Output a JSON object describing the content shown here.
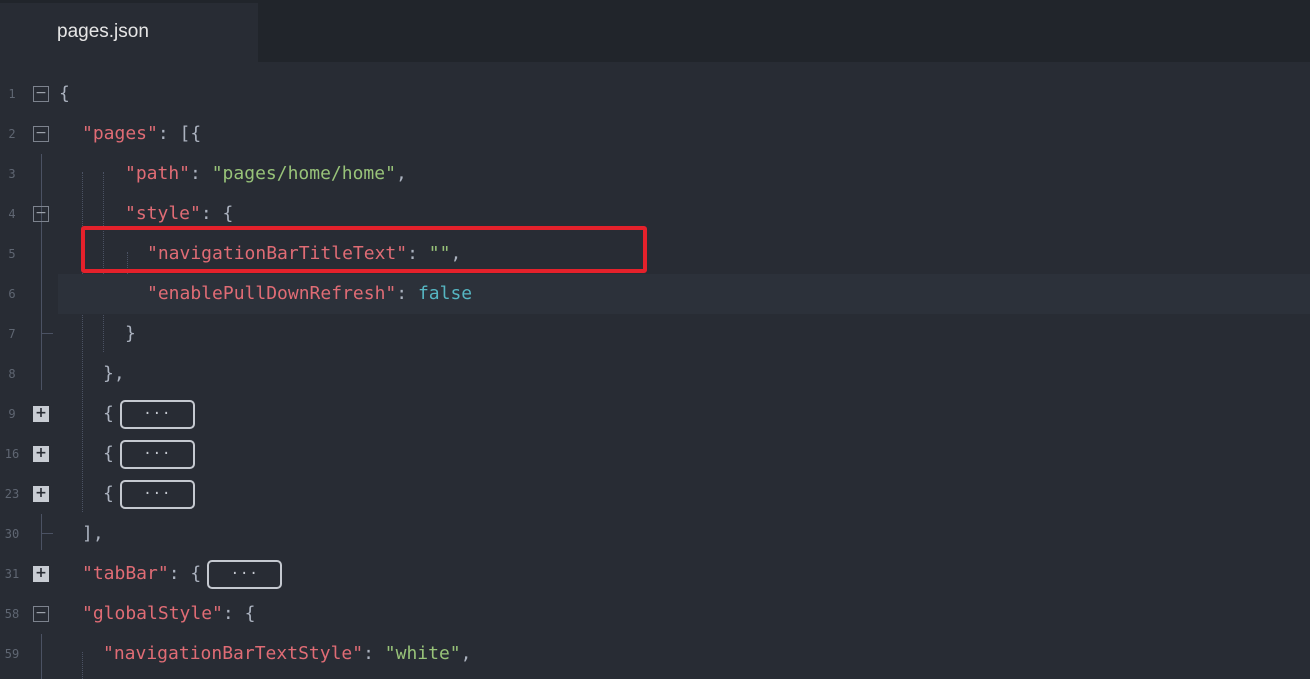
{
  "tab": {
    "label": "pages.json"
  },
  "lines": [
    {
      "num": "1",
      "fold": "minus"
    },
    {
      "num": "2",
      "fold": "minus"
    },
    {
      "num": "3",
      "fold": ""
    },
    {
      "num": "4",
      "fold": "minus"
    },
    {
      "num": "5",
      "fold": ""
    },
    {
      "num": "6",
      "fold": ""
    },
    {
      "num": "7",
      "fold": ""
    },
    {
      "num": "8",
      "fold": ""
    },
    {
      "num": "9",
      "fold": "plus"
    },
    {
      "num": "16",
      "fold": "plus"
    },
    {
      "num": "23",
      "fold": "plus"
    },
    {
      "num": "30",
      "fold": ""
    },
    {
      "num": "31",
      "fold": "plus"
    },
    {
      "num": "58",
      "fold": "minus"
    },
    {
      "num": "59",
      "fold": ""
    }
  ],
  "code": {
    "l1_open": "{",
    "l2_key": "\"pages\"",
    "l2_rest": ": [{",
    "l3_key": "\"path\"",
    "l3_colon": ": ",
    "l3_val": "\"pages/home/home\"",
    "l3_comma": ",",
    "l4_key": "\"style\"",
    "l4_rest": ": {",
    "l5_key": "\"navigationBarTitleText\"",
    "l5_colon": ": ",
    "l5_val": "\"\"",
    "l5_comma": ",",
    "l6_key": "\"enablePullDownRefresh\"",
    "l6_colon": ": ",
    "l6_val": "false",
    "l7_close": "}",
    "l8_close": "},",
    "l9_open": "{",
    "l16_open": "{",
    "l23_open": "{",
    "ellipsis": "···",
    "l30_close": "],",
    "l31_key": "\"tabBar\"",
    "l31_rest": ": {",
    "l58_key": "\"globalStyle\"",
    "l58_rest": ": {",
    "l59_key": "\"navigationBarTextStyle\"",
    "l59_colon": ": ",
    "l59_val": "\"white\"",
    "l59_comma": ","
  },
  "colors": {
    "key": "#e06c75",
    "string": "#98c379",
    "boolean": "#56b6c2",
    "highlight": "#e5212b"
  }
}
